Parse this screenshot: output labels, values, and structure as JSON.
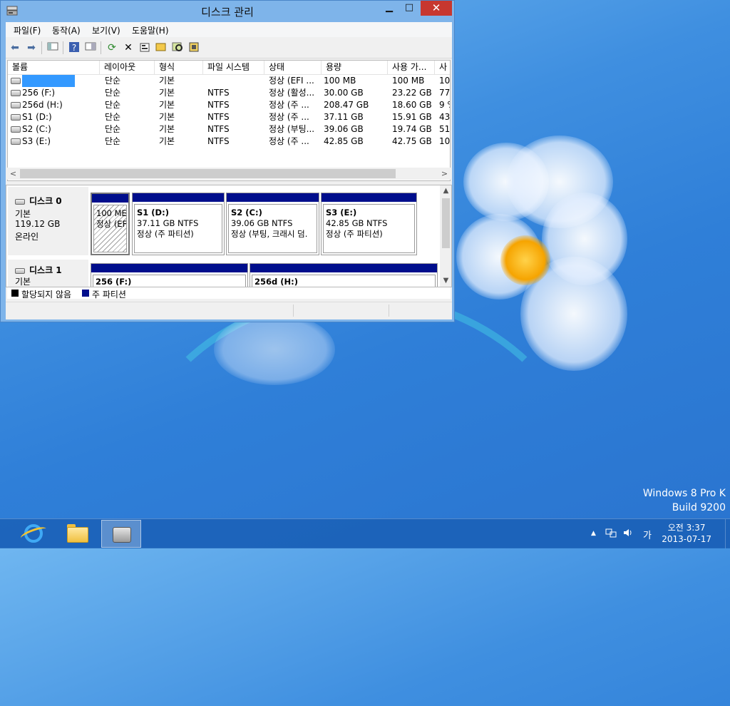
{
  "window": {
    "title": "디스크 관리",
    "min_glyph": "▁",
    "max_glyph": "□",
    "close_glyph": "✕"
  },
  "menu": [
    "파일(F)",
    "동작(A)",
    "보기(V)",
    "도움말(H)"
  ],
  "toolbar_icons": [
    "back-icon",
    "forward-icon",
    "console-tree-icon",
    "help-icon",
    "properties-view-icon",
    "refresh-icon",
    "delete-icon",
    "properties-icon",
    "open-icon",
    "explore-icon",
    "rescan-icon"
  ],
  "list": {
    "columns": [
      "볼륨",
      "레이아웃",
      "형식",
      "파일 시스템",
      "상태",
      "용량",
      "사용 가...",
      "사"
    ],
    "rows": [
      {
        "name": "",
        "layout": "단순",
        "type": "기본",
        "fs": "",
        "status": "정상 (EFI ...",
        "capacity": "100 MB",
        "free": "100 MB",
        "pct": "10("
      },
      {
        "name": "256 (F:)",
        "layout": "단순",
        "type": "기본",
        "fs": "NTFS",
        "status": "정상 (활성...",
        "capacity": "30.00 GB",
        "free": "23.22 GB",
        "pct": "77"
      },
      {
        "name": "256d (H:)",
        "layout": "단순",
        "type": "기본",
        "fs": "NTFS",
        "status": "정상 (주 ...",
        "capacity": "208.47 GB",
        "free": "18.60 GB",
        "pct": "9 %"
      },
      {
        "name": "S1 (D:)",
        "layout": "단순",
        "type": "기본",
        "fs": "NTFS",
        "status": "정상 (주 ...",
        "capacity": "37.11 GB",
        "free": "15.91 GB",
        "pct": "43"
      },
      {
        "name": "S2 (C:)",
        "layout": "단순",
        "type": "기본",
        "fs": "NTFS",
        "status": "정상 (부팅...",
        "capacity": "39.06 GB",
        "free": "19.74 GB",
        "pct": "51"
      },
      {
        "name": "S3 (E:)",
        "layout": "단순",
        "type": "기본",
        "fs": "NTFS",
        "status": "정상 (주 ...",
        "capacity": "42.85 GB",
        "free": "42.75 GB",
        "pct": "10("
      }
    ]
  },
  "disks": [
    {
      "name": "디스크 0",
      "kind": "기본",
      "size": "119.12 GB",
      "state": "온라인",
      "partitions": [
        {
          "title": "",
          "line1": "100 ME",
          "line2": "정상 (EF"
        },
        {
          "title": "S1  (D:)",
          "line1": "37.11 GB NTFS",
          "line2": "정상 (주 파티션)"
        },
        {
          "title": "S2  (C:)",
          "line1": "39.06 GB NTFS",
          "line2": "정상 (부팅, 크래시 덤."
        },
        {
          "title": "S3  (E:)",
          "line1": "42.85 GB NTFS",
          "line2": "정상 (주 파티션)"
        }
      ]
    },
    {
      "name": "디스크 1",
      "kind": "기본",
      "partitions": [
        {
          "title": "256  (F:)"
        },
        {
          "title": "256d  (H:)"
        }
      ]
    }
  ],
  "legend": {
    "unallocated": "할당되지 않음",
    "primary": "주 파티션",
    "unallocated_color": "#000000",
    "primary_color": "#000e8c"
  },
  "watermark": {
    "line1": "Windows 8 Pro K",
    "line2": "Build 9200"
  },
  "taskbar": {
    "apps": [
      "internet-explorer-icon",
      "file-explorer-icon",
      "disk-management-icon"
    ],
    "tray": {
      "chevron": "▲",
      "ime": "가"
    },
    "clock_time": "오전 3:37",
    "clock_date": "2013-07-17"
  }
}
